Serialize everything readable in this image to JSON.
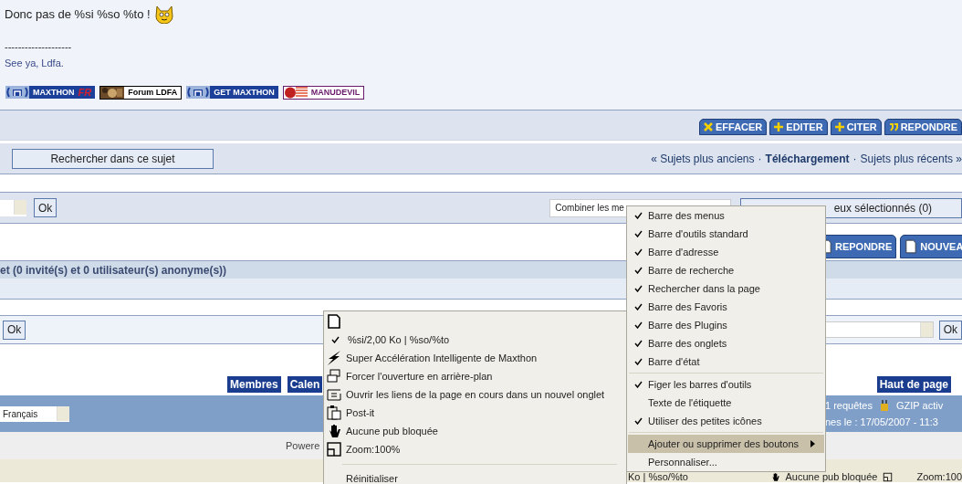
{
  "post": {
    "text": "Donc pas de %si %so %to !",
    "signature_rule": "--------------------",
    "signature": "See ya, Ldfa.",
    "banners": [
      {
        "kind": "maxthon",
        "label": "MAXTHON",
        "extra": "FR"
      },
      {
        "label": "Forum LDFA"
      },
      {
        "kind": "maxthon",
        "label": "GET MAXTHON"
      },
      {
        "kind": "flag",
        "label": "MANUDEVIL"
      }
    ]
  },
  "post_buttons": [
    {
      "kind": "delete",
      "label": "EFFACER"
    },
    {
      "kind": "plus",
      "label": "EDITER"
    },
    {
      "kind": "plus",
      "label": "CITER"
    },
    {
      "kind": "quote",
      "label": "REPONDRE"
    }
  ],
  "search_topic_button": "Rechercher dans ce sujet",
  "topic_nav": [
    {
      "kind": "link",
      "label": "« Sujets plus anciens"
    },
    {
      "kind": "sep",
      "label": "·"
    },
    {
      "kind": "current",
      "label": "Téléchargement"
    },
    {
      "kind": "sep",
      "label": "·"
    },
    {
      "kind": "link",
      "label": "Sujets plus récents »"
    }
  ],
  "moderation": {
    "ok": "Ok",
    "select_value": "Combiner les me",
    "selected_button": "eux sélectionnés (0)"
  },
  "topic_buttons": [
    "REPONDRE",
    "NOUVEA"
  ],
  "online_header": "et (0 invité(s) et 0 utilisateur(s) anonyme(s))",
  "jump": {
    "ok_left": "Ok",
    "ok_right": "Ok"
  },
  "footer_links": [
    "Membres",
    "Calen"
  ],
  "top_link": "Haut de page",
  "footer": {
    "language": "Français",
    "stats_1": "1 requêtes",
    "gzip": "GZIP activ",
    "stats_2": "nes le : 17/05/2007 - 11:3",
    "powered": "Powere"
  },
  "status_bar": {
    "left": "Ko | %so/%to",
    "ads": "Aucune pub bloquée",
    "zoom": "Zoom:100"
  },
  "toolbar_menu": [
    {
      "kind": "item",
      "label": "Barre des menus",
      "checked": true,
      "selected": false
    },
    {
      "kind": "item",
      "label": "Barre d'outils standard",
      "checked": true,
      "selected": false
    },
    {
      "kind": "item",
      "label": "Barre d'adresse",
      "checked": true,
      "selected": false
    },
    {
      "kind": "item",
      "label": "Barre de recherche",
      "checked": true,
      "selected": false
    },
    {
      "kind": "item",
      "label": "Rechercher dans la page",
      "checked": true,
      "selected": false
    },
    {
      "kind": "item",
      "label": "Barre des Favoris",
      "checked": true,
      "selected": false
    },
    {
      "kind": "item",
      "label": "Barre des Plugins",
      "checked": true,
      "selected": false
    },
    {
      "kind": "item",
      "label": "Barre des onglets",
      "checked": true,
      "selected": false
    },
    {
      "kind": "item",
      "label": "Barre d'état",
      "checked": true,
      "selected": false
    },
    {
      "kind": "separator"
    },
    {
      "kind": "item",
      "label": "Figer les barres d'outils",
      "checked": true,
      "selected": false
    },
    {
      "kind": "item",
      "label": "Texte de l'étiquette",
      "checked": false,
      "selected": false
    },
    {
      "kind": "item",
      "label": "Utiliser des petites icônes",
      "checked": true,
      "selected": false
    },
    {
      "kind": "separator"
    },
    {
      "kind": "submenu",
      "label": "Ajouter ou supprimer des boutons",
      "checked": false,
      "selected": true
    },
    {
      "kind": "item",
      "label": "Personnaliser...",
      "checked": false,
      "selected": false
    }
  ],
  "statusbar_menu": [
    {
      "kind": "icon_only"
    },
    {
      "kind": "item",
      "label": "%si/2,00 Ko | %so/%to",
      "checked": true
    },
    {
      "kind": "item",
      "label": "Super Accélération Intelligente de Maxthon",
      "checked": false
    },
    {
      "kind": "item",
      "label": "Forcer l'ouverture en arrière-plan",
      "checked": false
    },
    {
      "kind": "item",
      "label": "Ouvrir les liens de la page en cours dans un nouvel onglet",
      "checked": false
    },
    {
      "kind": "item",
      "label": "Post-it",
      "checked": false
    },
    {
      "kind": "item",
      "label": "Aucune pub bloquée",
      "checked": false
    },
    {
      "kind": "item",
      "label": "Zoom:100%",
      "checked": false
    },
    {
      "kind": "separator"
    },
    {
      "kind": "item",
      "label": "Réinitialiser",
      "checked": false
    }
  ]
}
